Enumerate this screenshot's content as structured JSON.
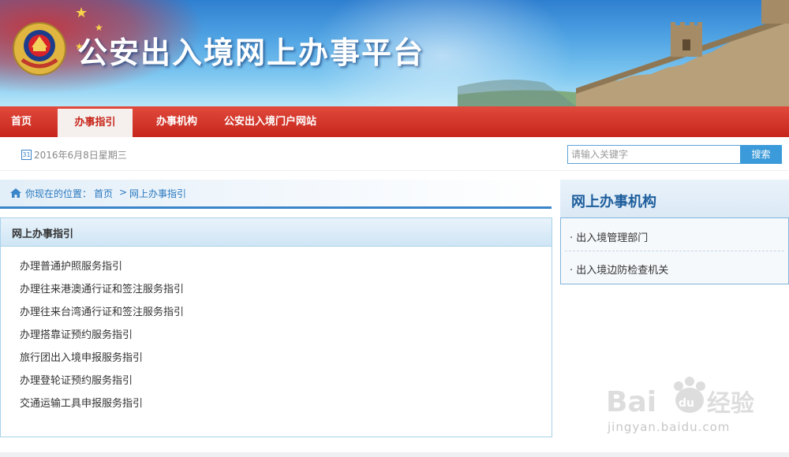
{
  "header": {
    "site_title": "公安出入境网上办事平台",
    "emblem_icon": "police-emblem-icon"
  },
  "nav": {
    "items": [
      {
        "label": "首页",
        "active": false
      },
      {
        "label": "办事指引",
        "active": true
      },
      {
        "label": "办事机构",
        "active": false
      },
      {
        "label": "公安出入境门户网站",
        "active": false
      }
    ]
  },
  "infobar": {
    "calendar_icon_text": "31",
    "date": "2016年6月8日星期三",
    "search": {
      "placeholder": "请输入关键字",
      "value": "",
      "button_label": "搜索"
    }
  },
  "breadcrumb": {
    "icon": "home-icon",
    "prefix": "你现在的位置：",
    "home": "首页",
    "separator": ">",
    "current": "网上办事指引"
  },
  "guide_panel": {
    "title": "网上办事指引",
    "links": [
      "办理普通护照服务指引",
      "办理往来港澳通行证和签注服务指引",
      "办理往来台湾通行证和签注服务指引",
      "办理搭靠证预约服务指引",
      "旅行团出入境申报服务指引",
      "办理登轮证预约服务指引",
      "交通运输工具申报服务指引"
    ]
  },
  "sidebar": {
    "title": "网上办事机构",
    "items": [
      "出入境管理部门",
      "出入境边防检查机关"
    ]
  },
  "watermark": {
    "logo": "Bai du 经验",
    "url": "jingyan.baidu.com"
  },
  "colors": {
    "nav_red": "#c7251b",
    "link_blue": "#2a78bf",
    "border_blue": "#a9d2ea",
    "search_button": "#3b9ad9"
  }
}
